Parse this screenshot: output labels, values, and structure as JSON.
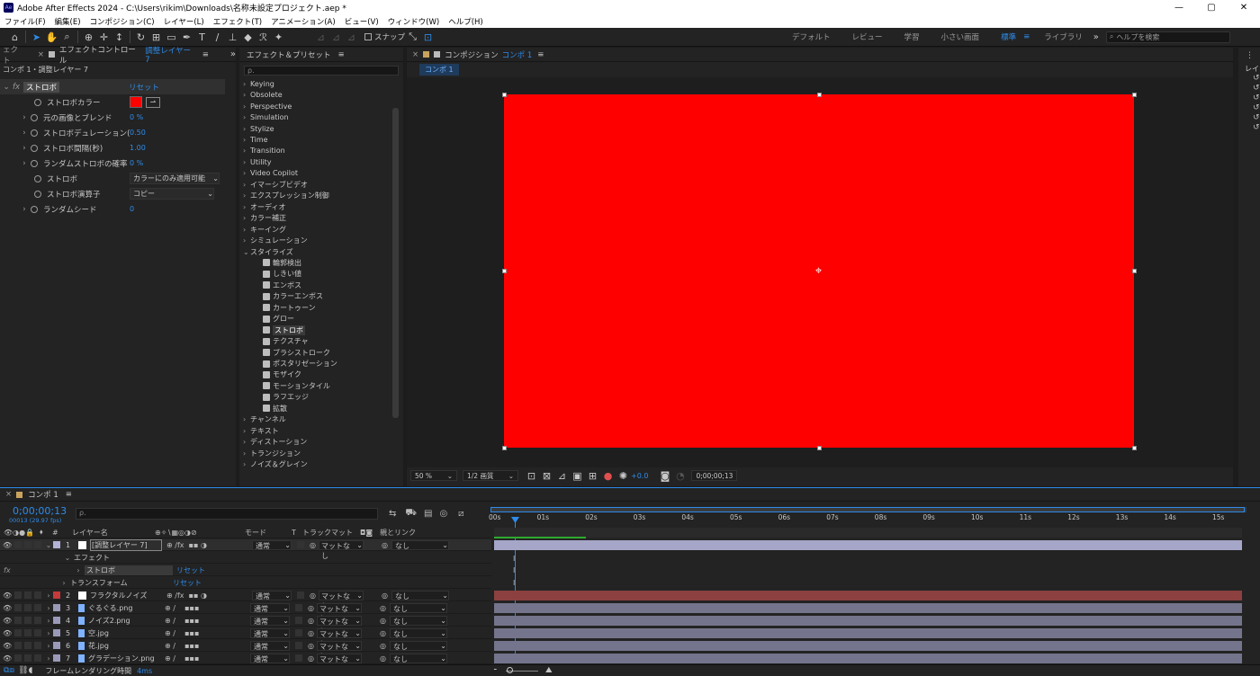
{
  "title_bar": {
    "title": "Adobe After Effects 2024 - C:\\Users\\rikim\\Downloads\\名称未設定プロジェクト.aep *",
    "app_icon": "Ae",
    "minimize": "—",
    "maximize": "▢",
    "close": "✕"
  },
  "menu": [
    "ファイル(F)",
    "編集(E)",
    "コンポジション(C)",
    "レイヤー(L)",
    "エフェクト(T)",
    "アニメーション(A)",
    "ビュー(V)",
    "ウィンドウ(W)",
    "ヘルプ(H)"
  ],
  "toolbar": {
    "snap_label": "スナップ",
    "workspaces": [
      "デフォルト",
      "レビュー",
      "学習",
      "小さい画面",
      "標準",
      "ライブラリ"
    ],
    "active_workspace": "標準",
    "more": "»",
    "help_placeholder": "ヘルプを検索"
  },
  "effect_controls": {
    "partial_tab": "ェクト",
    "tab_prefix": "エフェクトコントロール",
    "tab_layer": "調整レイヤー 7",
    "breadcrumb": "コンポ 1・調整レイヤー 7",
    "effect_name": "ストロボ",
    "reset": "リセット",
    "fx": "fx",
    "props": [
      {
        "label": "ストロボカラー",
        "type": "color",
        "color": "#ff0000"
      },
      {
        "label": "元の画像とブレンド",
        "value": "0 %"
      },
      {
        "label": "ストロボデュレーション(",
        "value": "0.50"
      },
      {
        "label": "ストロボ間隔(秒)",
        "value": "1.00"
      },
      {
        "label": "ランダムストロボの確率",
        "value": "0 %"
      },
      {
        "label": "ストロボ",
        "dropdown": "カラーにのみ適用可能"
      },
      {
        "label": "ストロボ演算子",
        "dropdown": "コピー"
      },
      {
        "label": "ランダムシード",
        "value": "0"
      }
    ]
  },
  "effects_presets": {
    "title": "エフェクト＆プリセット",
    "search_placeholder": "ρ.",
    "categories_top": [
      "Keying",
      "Obsolete",
      "Perspective",
      "Simulation",
      "Stylize",
      "Time",
      "Transition",
      "Utility",
      "Video Copilot",
      "イマーシブビデオ",
      "エクスプレッション制御",
      "オーディオ",
      "カラー補正",
      "キーイング",
      "シミュレーション"
    ],
    "open_category": "スタイライズ",
    "items": [
      "輪郭検出",
      "しきい値",
      "エンボス",
      "カラーエンボス",
      "カートゥーン",
      "グロー",
      "ストロボ",
      "テクスチャ",
      "ブラシストローク",
      "ポスタリゼーション",
      "モザイク",
      "モーションタイル",
      "ラフエッジ",
      "拡散"
    ],
    "selected_item": "ストロボ",
    "categories_bottom": [
      "チャンネル",
      "テキスト",
      "ディストーション",
      "トランジション",
      "ノイズ＆グレイン"
    ]
  },
  "composition": {
    "tab_prefix": "コンポジション",
    "tab_name": "コンポ 1",
    "sub_tab": "コンポ 1",
    "layer_color": "#ff0000",
    "zoom": "50 %",
    "resolution": "1/2 画質",
    "exposure": "+0.0",
    "timecode": "0;00;00;13"
  },
  "right_panel": {
    "label": "レイ"
  },
  "timeline": {
    "tab": "コンポ 1",
    "timecode": "0;00;00;13",
    "frame_info": "00013 (29.97 fps)",
    "search_placeholder": "ρ.",
    "col_layer_name": "レイヤー名",
    "col_mode": "モード",
    "col_t": "T",
    "col_trackmatte": "トラックマット",
    "col_parent": "親とリンク",
    "ruler": [
      "00s",
      "01s",
      "02s",
      "03s",
      "04s",
      "05s",
      "06s",
      "07s",
      "08s",
      "09s",
      "10s",
      "11s",
      "12s",
      "13s",
      "14s",
      "15s"
    ],
    "layers": [
      {
        "num": "1",
        "name": "[調整レイヤー 7]",
        "mode": "通常",
        "matte": "マットなし",
        "parent": "なし",
        "label_color": "#b4b4d8",
        "bar_color": "#a6a6c8",
        "selected": true
      },
      {
        "num": "2",
        "name": "フラクタルノイズ",
        "mode": "通常",
        "matte": "マットなし",
        "parent": "なし",
        "label_color": "#c53a3a",
        "bar_color": "#8c4040"
      },
      {
        "num": "3",
        "name": "ぐるぐる.png",
        "mode": "通常",
        "matte": "マットなし",
        "parent": "なし",
        "label_color": "#9a9ab8",
        "bar_color": "#74748c"
      },
      {
        "num": "4",
        "name": "ノイズ2.png",
        "mode": "通常",
        "matte": "マットなし",
        "parent": "なし",
        "label_color": "#9a9ab8",
        "bar_color": "#74748c"
      },
      {
        "num": "5",
        "name": "空.jpg",
        "mode": "通常",
        "matte": "マットなし",
        "parent": "なし",
        "label_color": "#9a9ab8",
        "bar_color": "#74748c"
      },
      {
        "num": "6",
        "name": "花.jpg",
        "mode": "通常",
        "matte": "マットなし",
        "parent": "なし",
        "label_color": "#9a9ab8",
        "bar_color": "#74748c"
      },
      {
        "num": "7",
        "name": "グラデーション.png",
        "mode": "通常",
        "matte": "マットなし",
        "parent": "なし",
        "label_color": "#9a9ab8",
        "bar_color": "#74748c"
      }
    ],
    "sub_effect": "エフェクト",
    "sub_strobe": "ストロボ",
    "sub_transform": "トランスフォーム",
    "reset": "リセット",
    "fx": "fx",
    "render_time_label": "フレームレンダリング時間",
    "render_time": "4ms"
  }
}
